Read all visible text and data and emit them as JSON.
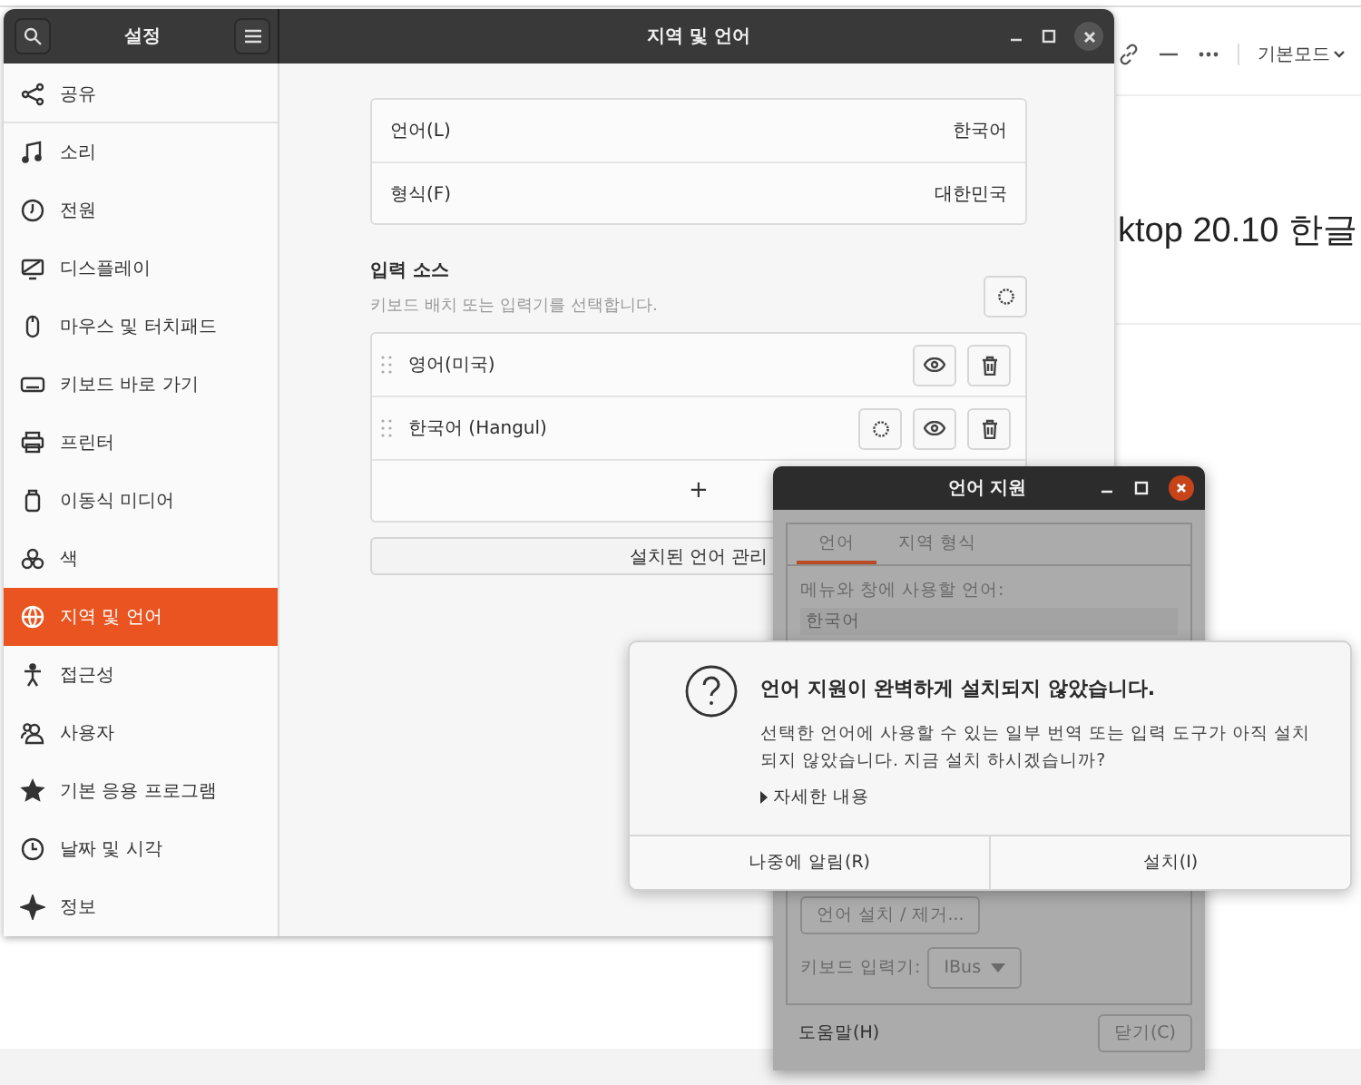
{
  "background_page": {
    "toolbar_label": "기본모드",
    "post_title": "ktop 20.10 한글"
  },
  "settings_window": {
    "sidebar_title": "설정",
    "title": "지역 및 언어",
    "sidebar_items": [
      {
        "label": "공유",
        "selected": false
      },
      {
        "label": "소리",
        "selected": false
      },
      {
        "label": "전원",
        "selected": false
      },
      {
        "label": "디스플레이",
        "selected": false
      },
      {
        "label": "마우스 및 터치패드",
        "selected": false
      },
      {
        "label": "키보드 바로 가기",
        "selected": false
      },
      {
        "label": "프린터",
        "selected": false
      },
      {
        "label": "이동식 미디어",
        "selected": false
      },
      {
        "label": "색",
        "selected": false
      },
      {
        "label": "지역 및 언어",
        "selected": true
      },
      {
        "label": "접근성",
        "selected": false
      },
      {
        "label": "사용자",
        "selected": false
      },
      {
        "label": "기본 응용 프로그램",
        "selected": false
      },
      {
        "label": "날짜 및 시각",
        "selected": false
      },
      {
        "label": "정보",
        "selected": false
      }
    ],
    "language_rows": [
      {
        "label": "언어(L)",
        "value": "한국어"
      },
      {
        "label": "형식(F)",
        "value": "대한민국"
      }
    ],
    "input_sources": {
      "heading": "입력 소스",
      "subtitle": "키보드 배치 또는 입력기를 선택합니다.",
      "add_label": "+",
      "sources": [
        {
          "name": "영어(미국)",
          "has_settings": false
        },
        {
          "name": "한국어 (Hangul)",
          "has_settings": true
        }
      ]
    },
    "manage_button": "설치된 언어 관리"
  },
  "language_support_window": {
    "title": "언어 지원",
    "tabs": [
      {
        "label": "언어",
        "selected": true
      },
      {
        "label": "지역 형식",
        "selected": false
      }
    ],
    "list_label": "메뉴와 창에 사용할 언어:",
    "languages": [
      "한국어"
    ],
    "install_button": "언어 설치 / 제거...",
    "keyboard_label": "키보드 입력기:",
    "keyboard_value": "IBus",
    "help_button": "도움말(H)",
    "close_button": "닫기(C)"
  },
  "dialog": {
    "title": "언어 지원이 완벽하게 설치되지 않았습니다.",
    "message": "선택한 언어에 사용할 수 있는 일부 번역 또는 입력 도구가 아직 설치되지 않았습니다. 지금 설치 하시겠습니까?",
    "details": "자세한 내용",
    "buttons": [
      "나중에 알림(R)",
      "설치(I)"
    ]
  }
}
